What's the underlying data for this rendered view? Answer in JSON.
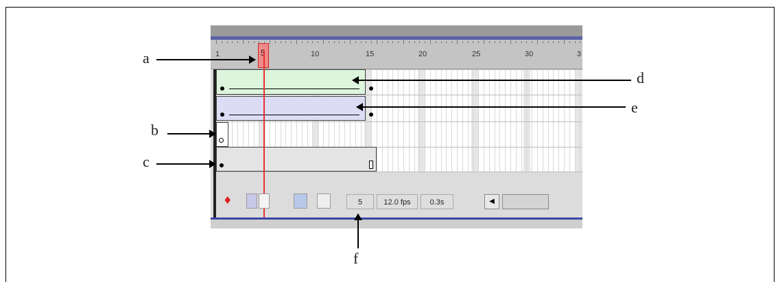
{
  "ruler": {
    "labels": [
      "1",
      "5",
      "10",
      "15",
      "20",
      "25",
      "30",
      "3"
    ],
    "current_frame": "5"
  },
  "controls": {
    "frame": "5",
    "fps": "12.0 fps",
    "time": "0.3s"
  },
  "callouts": {
    "a": "a",
    "b": "b",
    "c": "c",
    "d": "d",
    "e": "e",
    "f": "f"
  },
  "colors": {
    "playhead": "#e83030",
    "motion_tween": "#dcf5dc",
    "shape_tween": "#dcdcf5",
    "title_stripe": "#5b62a8"
  }
}
